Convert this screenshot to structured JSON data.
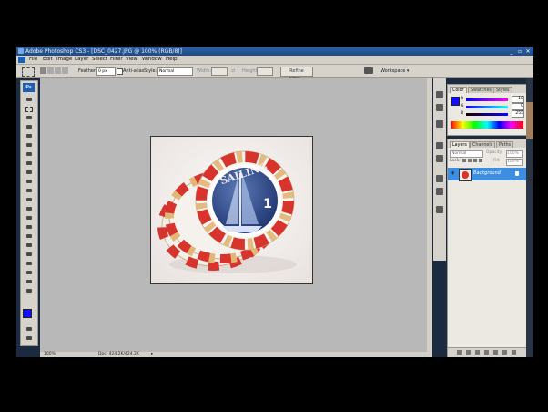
{
  "window": {
    "title": "Adobe Photoshop CS3 - [DSC_0427.JPG @ 100% (RGB/8)]",
    "controls": [
      "_",
      "▫",
      "✕"
    ]
  },
  "menu": [
    "File",
    "Edit",
    "Image",
    "Layer",
    "Select",
    "Filter",
    "View",
    "Window",
    "Help"
  ],
  "options": {
    "feather_label": "Feather:",
    "feather_value": "0 px",
    "anti_alias": "Anti-alias",
    "style_label": "Style:",
    "style_value": "Normal",
    "width_label": "Width:",
    "height_label": "Height:",
    "refine_edge": "Refine Edge...",
    "workspace": "Workspace ▾"
  },
  "status": {
    "zoom": "100%",
    "doc": "Doc: 424.2K/424.2K"
  },
  "color_panel": {
    "tabs": [
      "Color",
      "Swatches",
      "Styles"
    ],
    "r_label": "R",
    "r_value": "18",
    "g_label": "G",
    "g_value": "0",
    "b_label": "B",
    "b_value": "255"
  },
  "layers_panel": {
    "tabs": [
      "Layers",
      "Channels",
      "Paths"
    ],
    "blend": "Normal",
    "opacity_label": "Opacity:",
    "opacity_value": "100%",
    "lock_label": "Lock:",
    "fill_label": "Fill:",
    "fill_value": "100%",
    "layer_name": "Background"
  },
  "image": {
    "chip_text": "SAILING",
    "chip_number": "1"
  },
  "colors": {
    "foreground": "#1010ff",
    "background": "#ffffff",
    "selected_layer": "#3d8ee0"
  }
}
